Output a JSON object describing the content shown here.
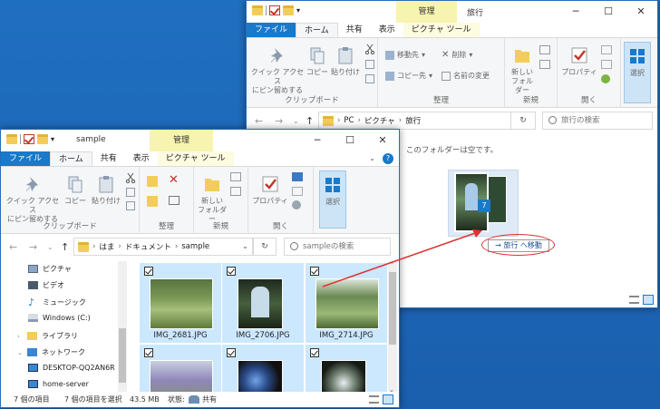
{
  "back_window": {
    "title": "旅行",
    "context_tab_title": "管理",
    "tabs": [
      "ファイル",
      "ホーム",
      "共有",
      "表示",
      "ピクチャ ツール"
    ],
    "ribbon": {
      "pin_label": "クイック アクセス\nにピン留めする",
      "copy_label": "コピー",
      "paste_label": "貼り付け",
      "clipboard_group": "クリップボード",
      "move_to": "移動先",
      "copy_to": "コピー先",
      "delete": "削除",
      "rename": "名前の変更",
      "organize_group": "整理",
      "new_folder": "新しい\nフォルダー",
      "new_group": "新規",
      "properties": "プロパティ",
      "open_group": "開く",
      "select": "選択"
    },
    "breadcrumb": [
      "PC",
      "ピクチャ",
      "旅行"
    ],
    "search_placeholder": "旅行の検索",
    "empty_message": "このフォルダーは空です。",
    "drag_count": "7",
    "drag_tooltip": "→ 旅行 へ移動"
  },
  "front_window": {
    "title": "sample",
    "context_tab_title": "管理",
    "tabs": [
      "ファイル",
      "ホーム",
      "共有",
      "表示",
      "ピクチャ ツール"
    ],
    "ribbon": {
      "pin_label": "クイック アクセス\nにピン留めする",
      "copy_label": "コピー",
      "paste_label": "貼り付け",
      "clipboard_group": "クリップボード",
      "organize_group": "整理",
      "new_folder": "新しい\nフォルダー",
      "new_group": "新規",
      "properties": "プロパティ",
      "open_group": "開く",
      "select": "選択"
    },
    "breadcrumb": [
      "はま",
      "ドキュメント",
      "sample"
    ],
    "search_placeholder": "sampleの検索",
    "nav_items": [
      "ピクチャ",
      "ビデオ",
      "ミュージック",
      "Windows (C:)",
      "ライブラリ",
      "ネットワーク",
      "DESKTOP-QQ2AN6R",
      "home-server"
    ],
    "files": [
      "IMG_2681.JPG",
      "IMG_2706.JPG",
      "IMG_2714.JPG",
      "",
      "",
      ""
    ],
    "status": {
      "count": "7 個の項目",
      "selected": "7 個の項目を選択",
      "size": "43.5 MB",
      "state_label": "状態:",
      "state_value": "共有"
    }
  },
  "colors": {
    "accent": "#1979ca",
    "selection": "#cce8ff",
    "context": "#f7f3b0",
    "arrow": "#e03030"
  }
}
